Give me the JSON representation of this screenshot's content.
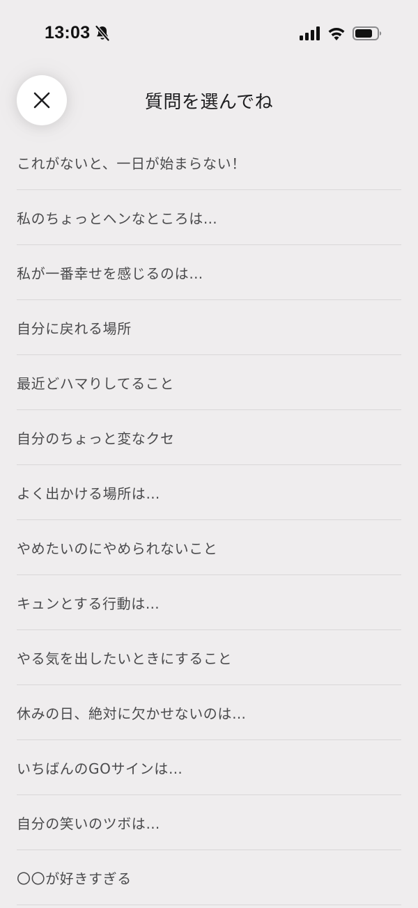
{
  "status_bar": {
    "time": "13:03",
    "icons": [
      "bell-off-icon",
      "signal-icon",
      "wifi-icon",
      "battery-icon"
    ]
  },
  "header": {
    "title": "質問を選んでね",
    "close_icon": "close-icon"
  },
  "questions": [
    "これがないと、一日が始まらない！",
    "私のちょっとヘンなところは…",
    "私が一番幸せを感じるのは…",
    "自分に戻れる場所",
    "最近どハマりしてること",
    "自分のちょっと変なクセ",
    "よく出かける場所は…",
    "やめたいのにやめられないこと",
    "キュンとする行動は…",
    "やる気を出したいときにすること",
    "休みの日、絶対に欠かせないのは…",
    "いちばんのGOサインは…",
    "自分の笑いのツボは…",
    "〇〇が好きすぎる"
  ],
  "colors": {
    "background": "#efedee",
    "text": "#4a4a4c",
    "divider": "#d9d7d8",
    "close_button_bg": "#ffffff"
  }
}
